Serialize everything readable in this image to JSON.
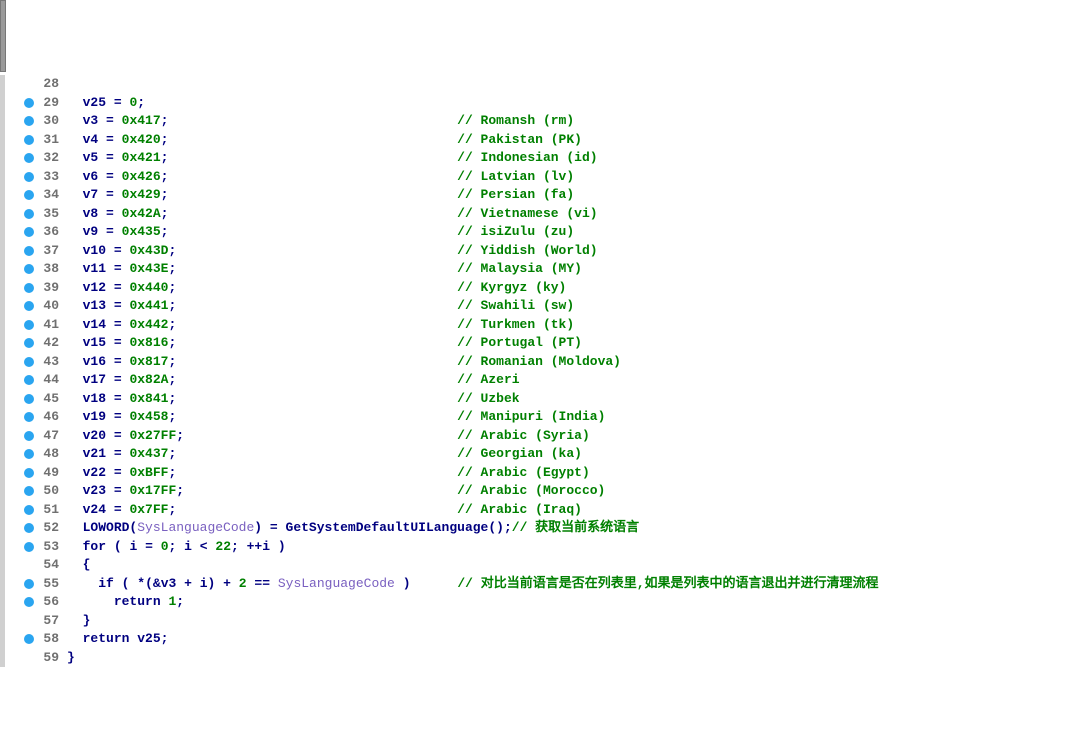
{
  "lines": [
    {
      "n": 28,
      "bp": false,
      "indent": 0,
      "kind": "blank"
    },
    {
      "n": 29,
      "bp": true,
      "indent": 1,
      "kind": "assign",
      "var": "v25",
      "val": "0",
      "comment": ""
    },
    {
      "n": 30,
      "bp": true,
      "indent": 1,
      "kind": "assign",
      "var": "v3",
      "val": "0x417",
      "comment": "// Romansh (rm)"
    },
    {
      "n": 31,
      "bp": true,
      "indent": 1,
      "kind": "assign",
      "var": "v4",
      "val": "0x420",
      "comment": "// Pakistan (PK)"
    },
    {
      "n": 32,
      "bp": true,
      "indent": 1,
      "kind": "assign",
      "var": "v5",
      "val": "0x421",
      "comment": "// Indonesian (id)"
    },
    {
      "n": 33,
      "bp": true,
      "indent": 1,
      "kind": "assign",
      "var": "v6",
      "val": "0x426",
      "comment": "// Latvian (lv)"
    },
    {
      "n": 34,
      "bp": true,
      "indent": 1,
      "kind": "assign",
      "var": "v7",
      "val": "0x429",
      "comment": "// Persian (fa)"
    },
    {
      "n": 35,
      "bp": true,
      "indent": 1,
      "kind": "assign",
      "var": "v8",
      "val": "0x42A",
      "comment": "// Vietnamese (vi)"
    },
    {
      "n": 36,
      "bp": true,
      "indent": 1,
      "kind": "assign",
      "var": "v9",
      "val": "0x435",
      "comment": "// isiZulu (zu)"
    },
    {
      "n": 37,
      "bp": true,
      "indent": 1,
      "kind": "assign",
      "var": "v10",
      "val": "0x43D",
      "comment": "// Yiddish (World)"
    },
    {
      "n": 38,
      "bp": true,
      "indent": 1,
      "kind": "assign",
      "var": "v11",
      "val": "0x43E",
      "comment": "// Malaysia (MY)"
    },
    {
      "n": 39,
      "bp": true,
      "indent": 1,
      "kind": "assign",
      "var": "v12",
      "val": "0x440",
      "comment": "// Kyrgyz (ky)"
    },
    {
      "n": 40,
      "bp": true,
      "indent": 1,
      "kind": "assign",
      "var": "v13",
      "val": "0x441",
      "comment": "// Swahili (sw)"
    },
    {
      "n": 41,
      "bp": true,
      "indent": 1,
      "kind": "assign",
      "var": "v14",
      "val": "0x442",
      "comment": "// Turkmen (tk)"
    },
    {
      "n": 42,
      "bp": true,
      "indent": 1,
      "kind": "assign",
      "var": "v15",
      "val": "0x816",
      "comment": "// Portugal (PT)"
    },
    {
      "n": 43,
      "bp": true,
      "indent": 1,
      "kind": "assign",
      "var": "v16",
      "val": "0x817",
      "comment": "// Romanian (Moldova)"
    },
    {
      "n": 44,
      "bp": true,
      "indent": 1,
      "kind": "assign",
      "var": "v17",
      "val": "0x82A",
      "comment": "// Azeri"
    },
    {
      "n": 45,
      "bp": true,
      "indent": 1,
      "kind": "assign",
      "var": "v18",
      "val": "0x841",
      "comment": "// Uzbek"
    },
    {
      "n": 46,
      "bp": true,
      "indent": 1,
      "kind": "assign",
      "var": "v19",
      "val": "0x458",
      "comment": "// Manipuri (India)"
    },
    {
      "n": 47,
      "bp": true,
      "indent": 1,
      "kind": "assign",
      "var": "v20",
      "val": "0x27FF",
      "comment": "// Arabic (Syria)"
    },
    {
      "n": 48,
      "bp": true,
      "indent": 1,
      "kind": "assign",
      "var": "v21",
      "val": "0x437",
      "comment": "// Georgian (ka)"
    },
    {
      "n": 49,
      "bp": true,
      "indent": 1,
      "kind": "assign",
      "var": "v22",
      "val": "0xBFF",
      "comment": "// Arabic (Egypt)"
    },
    {
      "n": 50,
      "bp": true,
      "indent": 1,
      "kind": "assign",
      "var": "v23",
      "val": "0x17FF",
      "comment": "// Arabic (Morocco)"
    },
    {
      "n": 51,
      "bp": true,
      "indent": 1,
      "kind": "assign",
      "var": "v24",
      "val": "0x7FF",
      "comment": "// Arabic (Iraq)"
    },
    {
      "n": 52,
      "bp": true,
      "indent": 1,
      "kind": "loword",
      "sym": "SysLanguageCode",
      "call": "GetSystemDefaultUILanguage",
      "comment": "// 获取当前系统语言"
    },
    {
      "n": 53,
      "bp": true,
      "indent": 1,
      "kind": "for",
      "init_var": "i",
      "init_val": "0",
      "cond_var": "i",
      "cond_op": "<",
      "cond_val": "22",
      "inc": "++i"
    },
    {
      "n": 54,
      "bp": false,
      "indent": 1,
      "kind": "brace_open"
    },
    {
      "n": 55,
      "bp": true,
      "indent": 2,
      "kind": "if",
      "expr_pre": "*(&",
      "expr_v": "v3",
      "expr_mid": " + ",
      "expr_i": "i",
      "expr_post": ") + ",
      "expr_add": "2",
      "expr_cmp": " == ",
      "expr_sym": "SysLanguageCode",
      "comment": "// 对比当前语言是否在列表里,如果是列表中的语言退出并进行清理流程"
    },
    {
      "n": 56,
      "bp": true,
      "indent": 3,
      "kind": "return",
      "var": "",
      "val": "1"
    },
    {
      "n": 57,
      "bp": false,
      "indent": 1,
      "kind": "brace_close"
    },
    {
      "n": 58,
      "bp": true,
      "indent": 1,
      "kind": "return",
      "var": "v25",
      "val": ""
    },
    {
      "n": 59,
      "bp": false,
      "indent": 0,
      "kind": "brace_close"
    }
  ],
  "comment_col": 50
}
